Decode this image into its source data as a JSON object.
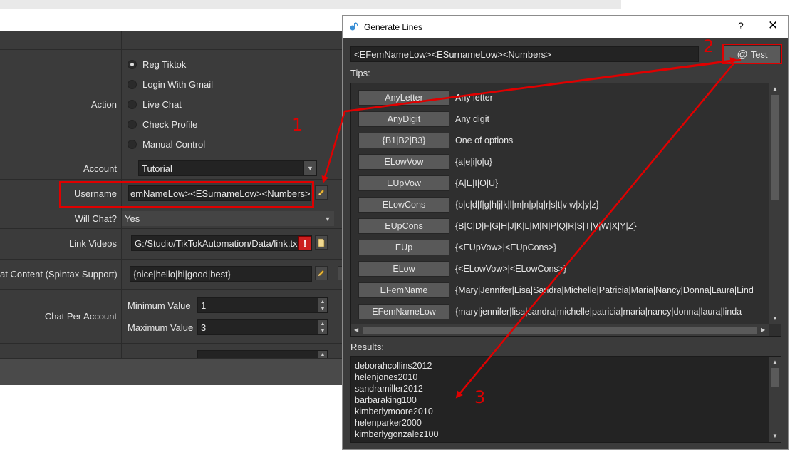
{
  "main": {
    "action_label": "Action",
    "actions": [
      "Reg Tiktok",
      "Login With Gmail",
      "Live Chat",
      "Check Profile",
      "Manual Control"
    ],
    "account_label": "Account",
    "account_value": "Tutorial",
    "username_label": "Username",
    "username_value": "emNameLow><ESurnameLow><Numbers>",
    "will_chat_label": "Will Chat?",
    "will_chat_value": "Yes",
    "link_videos_label": "Link Videos",
    "link_videos_value": "G:/Studio/TikTokAutomation/Data/link.txt",
    "chat_content_label": "at Content (Spintax Support)",
    "chat_content_value": "{nice|hello|hi|good|best}",
    "chat_per_account_label": "Chat Per Account",
    "min_label": "Minimum Value",
    "min_value": "1",
    "max_label": "Maximum Value",
    "max_value": "3"
  },
  "dialog": {
    "title": "Generate Lines",
    "help": "?",
    "close": "✕",
    "pattern": "<EFemNameLow><ESurnameLow><Numbers>",
    "test_at": "@",
    "test_label": "Test",
    "tips_label": "Tips:",
    "tips": [
      {
        "name": "AnyLetter",
        "desc": "Any letter"
      },
      {
        "name": "AnyDigit",
        "desc": "Any digit"
      },
      {
        "name": "{B1|B2|B3}",
        "desc": "One of options"
      },
      {
        "name": "ELowVow",
        "desc": "{a|e|i|o|u}"
      },
      {
        "name": "EUpVow",
        "desc": "{A|E|I|O|U}"
      },
      {
        "name": "ELowCons",
        "desc": "{b|c|d|f|g|h|j|k|l|m|n|p|q|r|s|t|v|w|x|y|z}"
      },
      {
        "name": "EUpCons",
        "desc": "{B|C|D|F|G|H|J|K|L|M|N|P|Q|R|S|T|V|W|X|Y|Z}"
      },
      {
        "name": "EUp",
        "desc": "{<EUpVow>|<EUpCons>}"
      },
      {
        "name": "ELow",
        "desc": "{<ELowVow>|<ELowCons>}"
      },
      {
        "name": "EFemName",
        "desc": "{Mary|Jennifer|Lisa|Sandra|Michelle|Patricia|Maria|Nancy|Donna|Laura|Lind"
      },
      {
        "name": "EFemNameLow",
        "desc": "{mary|jennifer|lisa|sandra|michelle|patricia|maria|nancy|donna|laura|linda"
      }
    ],
    "results_label": "Results:",
    "results": [
      "deborahcollins2012",
      "helenjones2010",
      "sandramiller2012",
      "barbaraking100",
      "kimberlymoore2010",
      "helenparker2000",
      "kimberlygonzalez100"
    ]
  },
  "annotations": [
    "1",
    "2",
    "3"
  ],
  "colors": {
    "annotation": "#e00000",
    "panel": "#3b3b3b",
    "field": "#232323"
  }
}
